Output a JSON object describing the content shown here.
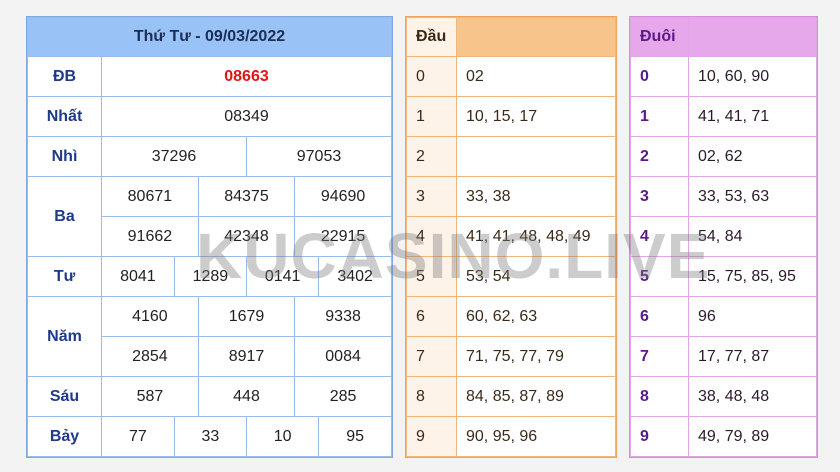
{
  "results": {
    "title": "Thứ Tư - 09/03/2022",
    "prizes": [
      {
        "label": "ĐB",
        "rows": [
          [
            "08663"
          ]
        ]
      },
      {
        "label": "Nhất",
        "rows": [
          [
            "08349"
          ]
        ]
      },
      {
        "label": "Nhì",
        "rows": [
          [
            "37296",
            "97053"
          ]
        ]
      },
      {
        "label": "Ba",
        "rows": [
          [
            "80671",
            "84375",
            "94690"
          ],
          [
            "91662",
            "42348",
            "22915"
          ]
        ]
      },
      {
        "label": "Tư",
        "rows": [
          [
            "8041",
            "1289",
            "0141",
            "3402"
          ]
        ]
      },
      {
        "label": "Năm",
        "rows": [
          [
            "4160",
            "1679",
            "9338"
          ],
          [
            "2854",
            "8917",
            "0084"
          ]
        ]
      },
      {
        "label": "Sáu",
        "rows": [
          [
            "587",
            "448",
            "285"
          ]
        ]
      },
      {
        "label": "Bảy",
        "rows": [
          [
            "77",
            "33",
            "10",
            "95"
          ]
        ]
      }
    ]
  },
  "dau": {
    "header": "Đầu",
    "rows": [
      {
        "digit": "0",
        "values": "02"
      },
      {
        "digit": "1",
        "values": "10, 15, 17"
      },
      {
        "digit": "2",
        "values": ""
      },
      {
        "digit": "3",
        "values": "33, 38"
      },
      {
        "digit": "4",
        "values": "41, 41, 48, 48, 49"
      },
      {
        "digit": "5",
        "values": "53, 54"
      },
      {
        "digit": "6",
        "values": "60, 62, 63"
      },
      {
        "digit": "7",
        "values": "71, 75, 77, 79"
      },
      {
        "digit": "8",
        "values": "84, 85, 87, 89"
      },
      {
        "digit": "9",
        "values": "90, 95, 96"
      }
    ]
  },
  "duoi": {
    "header": "Đuôi",
    "rows": [
      {
        "digit": "0",
        "values": "10, 60, 90"
      },
      {
        "digit": "1",
        "values": "41, 41, 71"
      },
      {
        "digit": "2",
        "values": "02, 62"
      },
      {
        "digit": "3",
        "values": "33, 53, 63"
      },
      {
        "digit": "4",
        "values": "54, 84"
      },
      {
        "digit": "5",
        "values": "15, 75, 85, 95"
      },
      {
        "digit": "6",
        "values": "96"
      },
      {
        "digit": "7",
        "values": "17, 77, 87"
      },
      {
        "digit": "8",
        "values": "38, 48, 48"
      },
      {
        "digit": "9",
        "values": "49, 79, 89"
      }
    ]
  },
  "watermark": "KUCASINO.LIVE",
  "colors": {
    "special": "#e31414",
    "main_header": "#99c2f7",
    "dau_header": "#f7c48c",
    "duoi_header": "#e6a8ea"
  }
}
